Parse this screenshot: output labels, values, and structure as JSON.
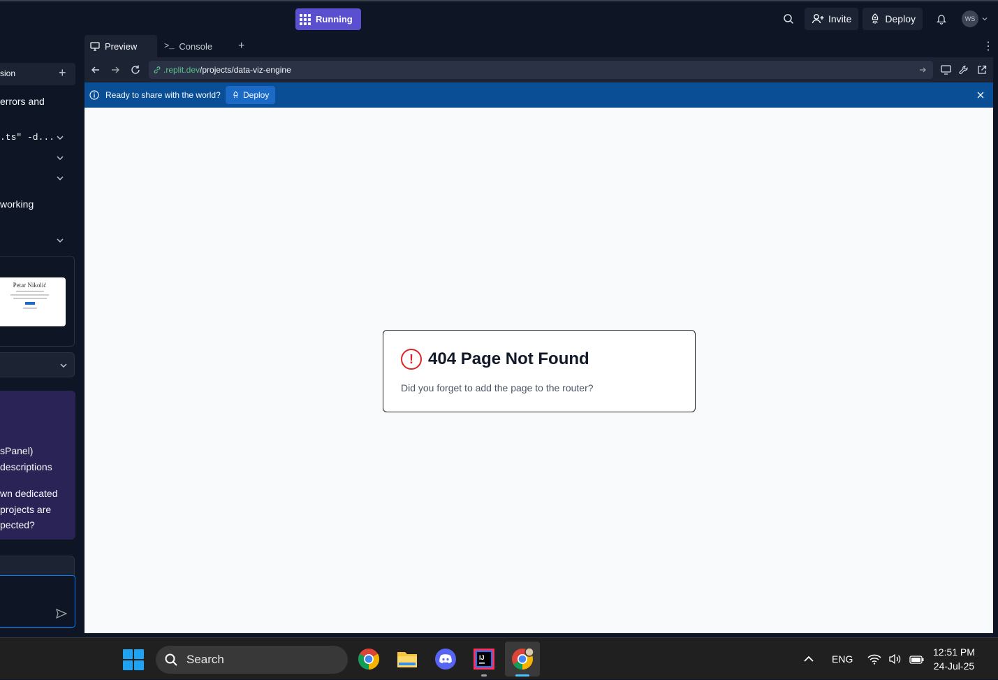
{
  "topbar": {
    "run_status": "Running",
    "invite_label": "Invite",
    "deploy_label": "Deploy",
    "avatar_initials": "WS"
  },
  "left_panel": {
    "header_fragment": "sion",
    "line1": "errors and",
    "code_line": ".ts\" -d...",
    "line_working": "working",
    "thumb_title": "Petar Nikolić",
    "purple_lines": [
      "sPanel)",
      "descriptions",
      "wn dedicated",
      "projects are",
      "pected?"
    ]
  },
  "tabs": {
    "preview": "Preview",
    "console": "Console",
    "add": "+"
  },
  "url": {
    "domain": ".replit.dev",
    "path": "/projects/data-viz-engine"
  },
  "banner": {
    "text": "Ready to share with the world?",
    "deploy_label": "Deploy"
  },
  "page": {
    "title": "404 Page Not Found",
    "message": "Did you forget to add the page to the router?",
    "error_glyph": "!"
  },
  "taskbar": {
    "search_label": "Search",
    "language": "ENG",
    "time": "12:51 PM",
    "date": "24-Jul-25"
  },
  "colors": {
    "accent": "#5a4fcf",
    "banner": "#0a4f96",
    "error": "#dc2626",
    "link_green": "#58c08a"
  }
}
